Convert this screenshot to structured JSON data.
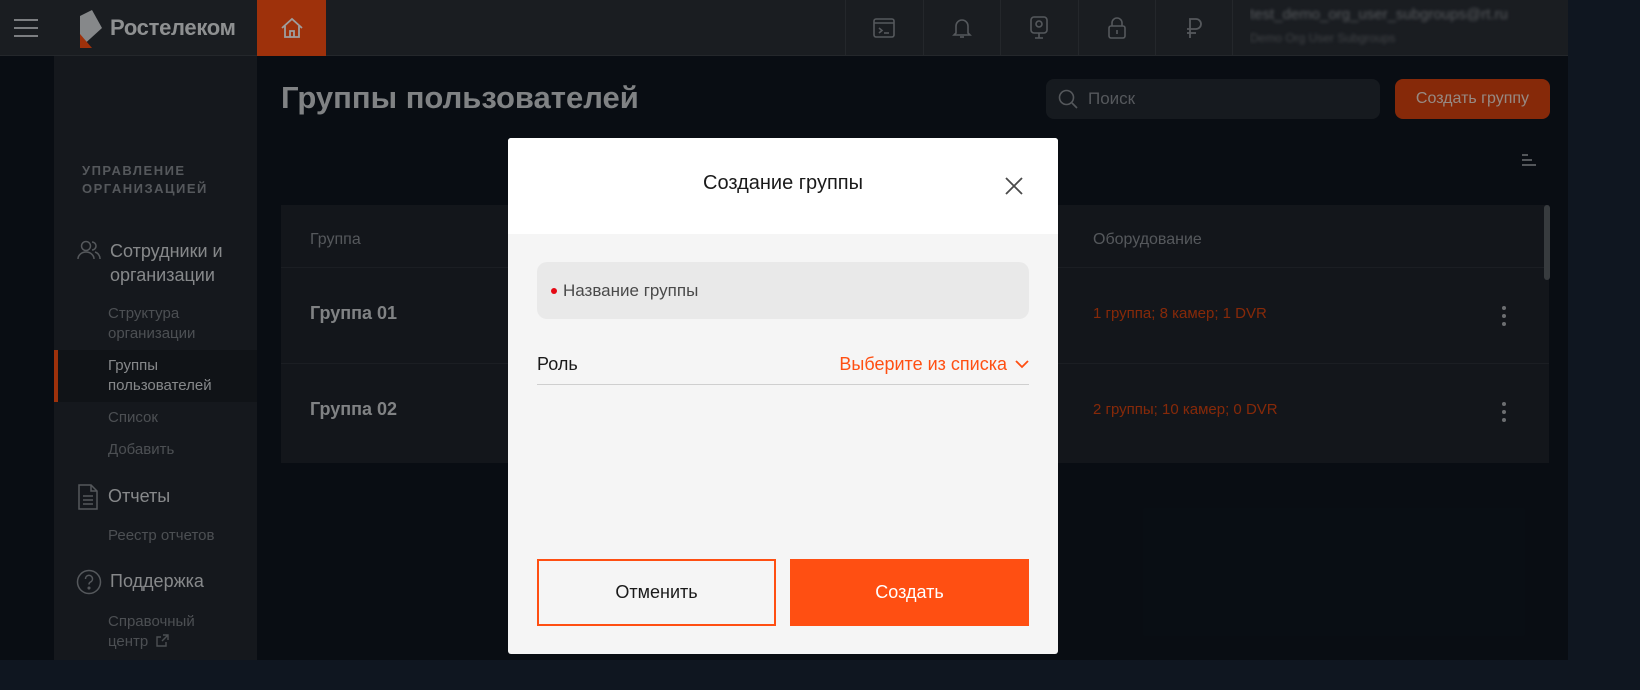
{
  "app": {
    "brand": "Ростелеком",
    "user": {
      "email": "test_demo_org_user_subgroups@rt.ru",
      "org": "Demo Org User Subgroups"
    }
  },
  "colors": {
    "accent": "#ff4f12",
    "accent_dark": "#d9430f",
    "background": "#0f1620",
    "sidebar": "#232830",
    "topbar": "#2a2f36",
    "modal_bg": "#f5f5f5",
    "required": "#e50914"
  },
  "topbar": {
    "icons": [
      "terminal-icon",
      "bell-icon",
      "camera-icon",
      "lock-icon",
      "ruble-icon"
    ]
  },
  "sidebar": {
    "section_title": "УПРАВЛЕНИЕ ОРГАНИЗАЦИЕЙ",
    "groups": [
      {
        "label": "Сотрудники и организации",
        "icon": "users-icon",
        "items": [
          "Структура организации",
          "Группы пользователей",
          "Список",
          "Добавить"
        ]
      },
      {
        "label": "Отчеты",
        "icon": "document-icon",
        "items": [
          "Реестр отчетов"
        ]
      },
      {
        "label": "Поддержка",
        "icon": "help-icon",
        "items": [
          "Справочный центр"
        ]
      }
    ],
    "active_item": "Группы пользователей"
  },
  "main": {
    "title": "Группы пользователей",
    "search_placeholder": "Поиск",
    "create_button": "Создать группу",
    "table": {
      "columns": [
        "Группа",
        "Оборудование"
      ],
      "rows": [
        {
          "name": "Группа 01",
          "equipment": "1 группа; 8 камер; 1 DVR"
        },
        {
          "name": "Группа 02",
          "equipment": "2 группы; 10 камер; 0 DVR"
        }
      ]
    }
  },
  "modal": {
    "title": "Создание группы",
    "name_placeholder": "Название группы",
    "role_label": "Роль",
    "role_select": "Выберите из списка",
    "cancel": "Отменить",
    "submit": "Создать"
  }
}
